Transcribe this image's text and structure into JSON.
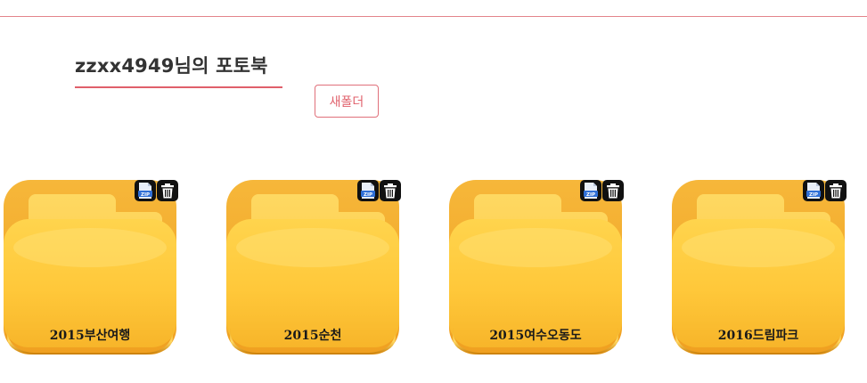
{
  "header": {
    "title": "zzxx4949님의 포토북",
    "new_folder_label": "새폴더"
  },
  "folders": [
    {
      "label": "2015부산여행"
    },
    {
      "label": "2015순천"
    },
    {
      "label": "2015여수오동도"
    },
    {
      "label": "2016드림파크"
    }
  ],
  "icons": {
    "zip": "zip-file-icon",
    "zip_text": "ZIP",
    "trash": "trash-icon"
  },
  "colors": {
    "accent": "#e0606b",
    "folder_light": "#ffd24a",
    "folder_dark": "#f4a92a"
  }
}
